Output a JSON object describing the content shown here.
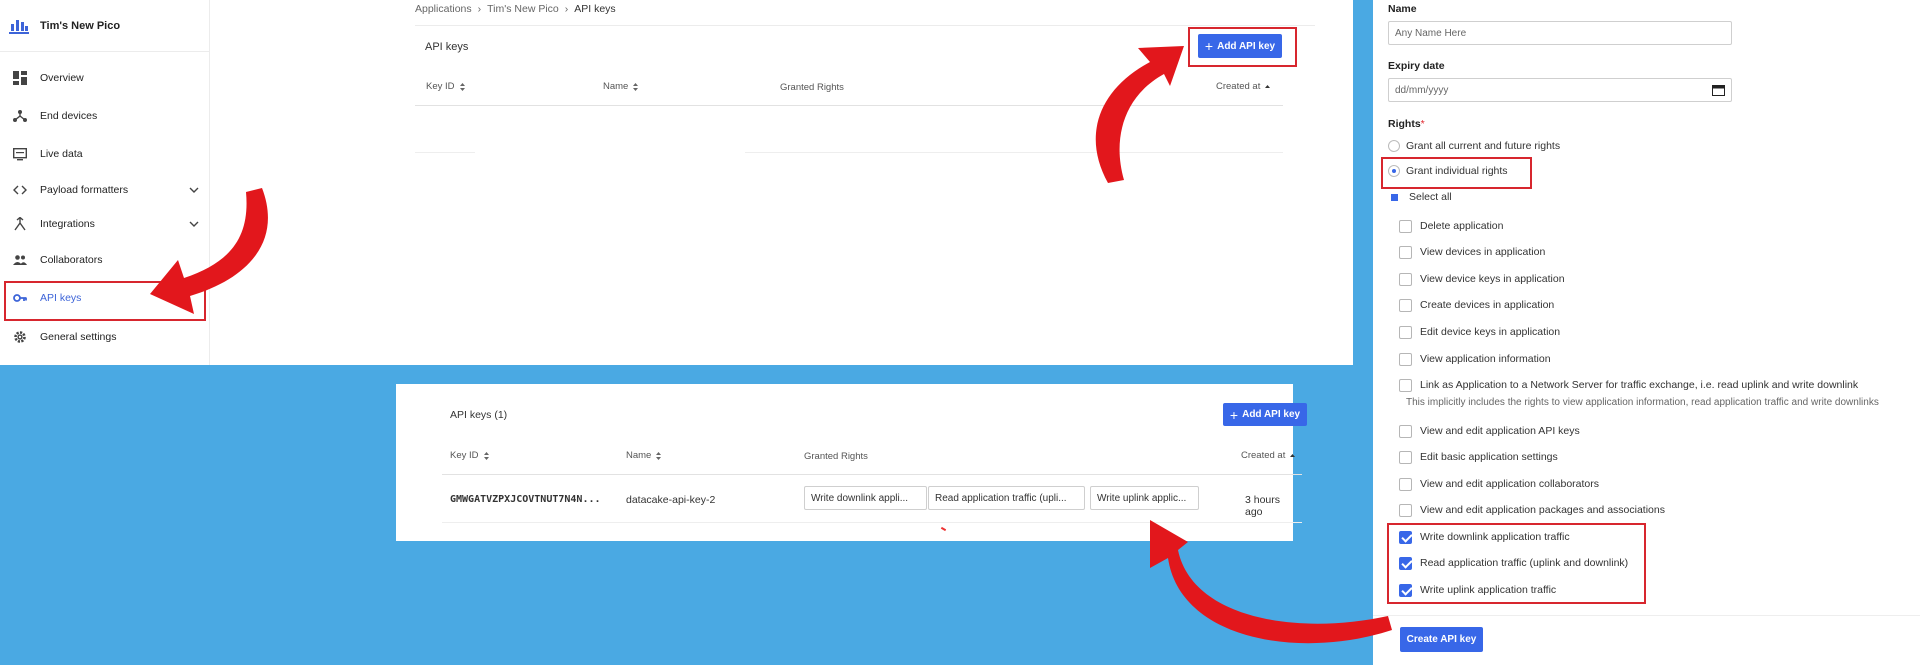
{
  "console": {
    "app_title": "Tim's New Pico",
    "sidebar": {
      "items": [
        {
          "label": "Overview",
          "icon": "grid-icon"
        },
        {
          "label": "End devices",
          "icon": "network-icon"
        },
        {
          "label": "Live data",
          "icon": "monitor-icon"
        },
        {
          "label": "Payload formatters",
          "icon": "code-icon"
        },
        {
          "label": "Integrations",
          "icon": "fork-icon"
        },
        {
          "label": "Collaborators",
          "icon": "people-icon"
        },
        {
          "label": "API keys",
          "icon": "key-icon"
        },
        {
          "label": "General settings",
          "icon": "gear-icon"
        }
      ],
      "active": "API keys"
    },
    "breadcrumb": [
      "Applications",
      "Tim's New Pico",
      "API keys"
    ],
    "title": "API keys",
    "add_button": "Add API key",
    "columns": [
      "Key ID",
      "Name",
      "Granted Rights",
      "Created at"
    ]
  },
  "list": {
    "title": "API keys (1)",
    "add_button": "Add API key",
    "columns": [
      "Key ID",
      "Name",
      "Granted Rights",
      "Created at"
    ],
    "rows": [
      {
        "key_id": "GMWGATVZPXJCOVTNUT7N4N...",
        "name": "datacake-api-key-2",
        "rights": [
          "Write downlink appli...",
          "Read application traffic (upli...",
          "Write uplink applic..."
        ],
        "created_at": "3 hours ago"
      }
    ]
  },
  "form": {
    "name_label": "Name",
    "name_placeholder": "Any Name Here",
    "expiry_label": "Expiry date",
    "expiry_placeholder": "dd/mm/yyyy",
    "rights_label": "Rights",
    "required_mark": "*",
    "grant_all": "Grant all current and future rights",
    "grant_individual": "Grant individual rights",
    "select_all": "Select all",
    "rights": [
      {
        "label": "Delete application",
        "checked": false
      },
      {
        "label": "View devices in application",
        "checked": false
      },
      {
        "label": "View device keys in application",
        "checked": false
      },
      {
        "label": "Create devices in application",
        "checked": false
      },
      {
        "label": "Edit device keys in application",
        "checked": false
      },
      {
        "label": "View application information",
        "checked": false
      },
      {
        "label": "Link as Application to a Network Server for traffic exchange, i.e. read uplink and write downlink",
        "checked": false
      },
      {
        "label": "View and edit application API keys",
        "checked": false
      },
      {
        "label": "Edit basic application settings",
        "checked": false
      },
      {
        "label": "View and edit application collaborators",
        "checked": false
      },
      {
        "label": "View and edit application packages and associations",
        "checked": false
      },
      {
        "label": "Write downlink application traffic",
        "checked": true
      },
      {
        "label": "Read application traffic (uplink and downlink)",
        "checked": true
      },
      {
        "label": "Write uplink application traffic",
        "checked": true
      }
    ],
    "link_hint": "This implicitly includes the rights to view application information, read application traffic and write downlinks",
    "create_button": "Create API key"
  },
  "colors": {
    "background": "#4aa9e3",
    "accent": "#3867e8",
    "highlight": "#d7262e"
  }
}
